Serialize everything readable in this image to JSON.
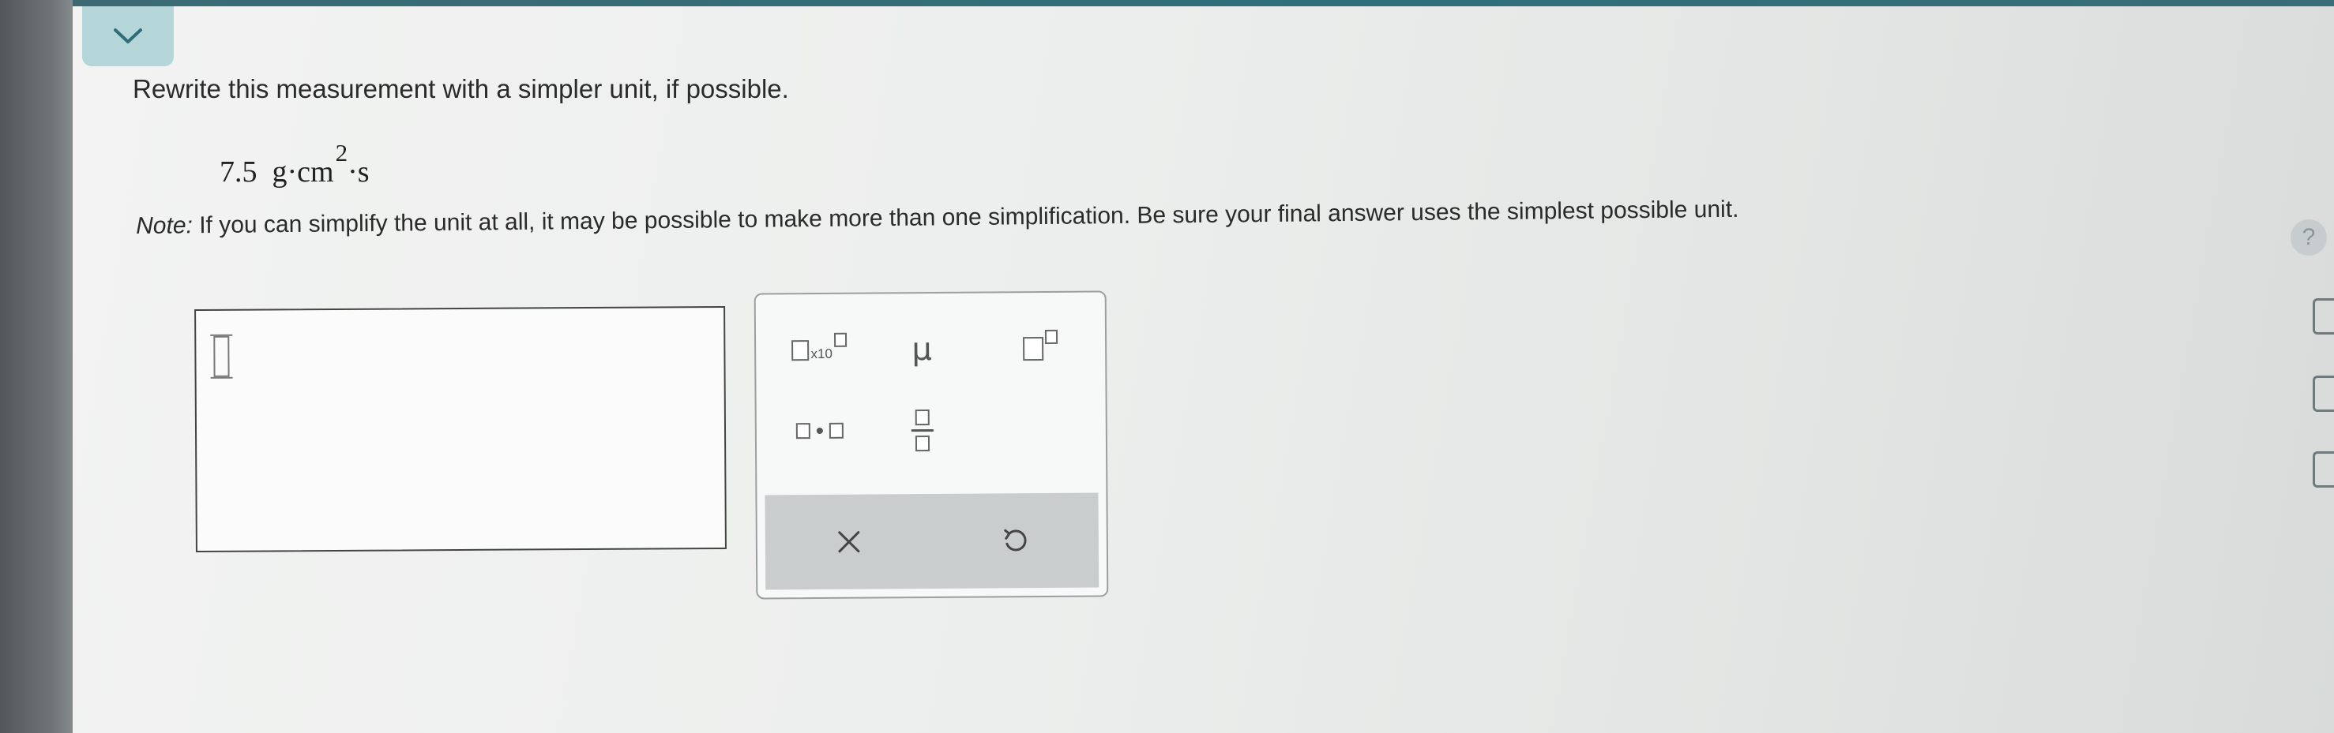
{
  "question": {
    "prompt": "Rewrite this measurement with a simpler unit, if possible.",
    "measurement": {
      "value": "7.5",
      "unit_main": "g·cm",
      "exponent": "2",
      "unit_tail": "·s"
    },
    "note_label": "Note:",
    "note_text": "If you can simplify the unit at all, it may be possible to make more than one simplification. Be sure your final answer uses the simplest possible unit."
  },
  "toolbar": {
    "sci_times_label": "x10",
    "mu_symbol": "μ"
  },
  "actions": {
    "clear_symbol": "×",
    "undo_symbol": "↺"
  },
  "side": {
    "help_symbol": "?"
  }
}
